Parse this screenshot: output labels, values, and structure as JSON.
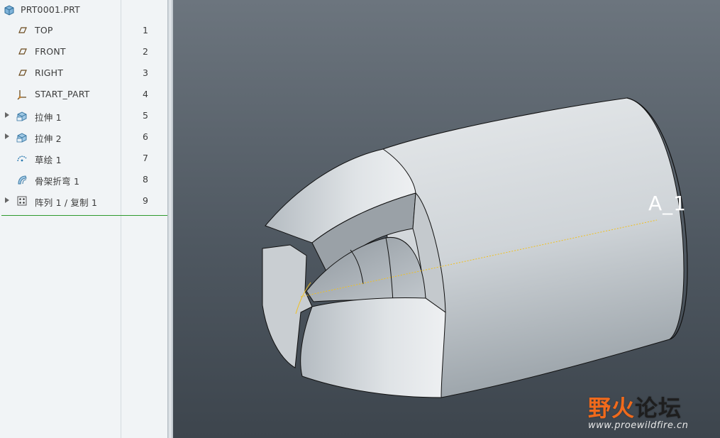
{
  "model_tree": {
    "root": {
      "label": "PRT0001.PRT",
      "icon": "part-icon"
    },
    "items": [
      {
        "label": "TOP",
        "number": "1",
        "icon": "datum-plane-icon",
        "expandable": false
      },
      {
        "label": "FRONT",
        "number": "2",
        "icon": "datum-plane-icon",
        "expandable": false
      },
      {
        "label": "RIGHT",
        "number": "3",
        "icon": "datum-plane-icon",
        "expandable": false
      },
      {
        "label": "START_PART",
        "number": "4",
        "icon": "coordinate-system-icon",
        "expandable": false
      },
      {
        "label": "拉伸 1",
        "number": "5",
        "icon": "extrude-icon",
        "expandable": true
      },
      {
        "label": "拉伸 2",
        "number": "6",
        "icon": "extrude-icon",
        "expandable": true
      },
      {
        "label": "草绘 1",
        "number": "7",
        "icon": "sketch-icon",
        "expandable": false
      },
      {
        "label": "骨架折弯 1",
        "number": "8",
        "icon": "spinal-bend-icon",
        "expandable": false
      },
      {
        "label": "阵列 1 / 复制 1",
        "number": "9",
        "icon": "pattern-icon",
        "expandable": true
      }
    ]
  },
  "viewport": {
    "axis_label": "A_1",
    "colors": {
      "background_top": "#6c757e",
      "background_bottom": "#3d454d",
      "axis_line": "#f0c020",
      "part_surface": "#d8dcdf"
    }
  },
  "watermark": {
    "logo_accent": "野火",
    "logo_rest": "论坛",
    "url": "www.proewildfire.cn"
  }
}
